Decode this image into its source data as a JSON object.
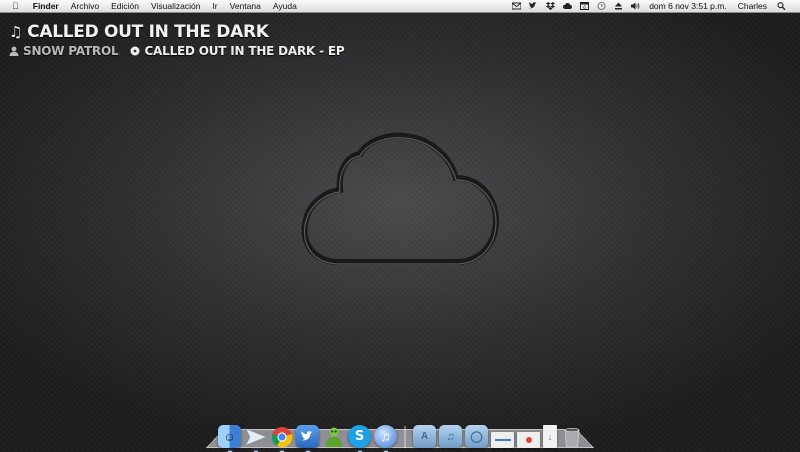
{
  "menubar": {
    "app_name": "Finder",
    "menus": [
      "Archivo",
      "Edición",
      "Visualización",
      "Ir",
      "Ventana",
      "Ayuda"
    ],
    "clock": "dom 6 nov  3:51 p.m.",
    "user": "Charles",
    "status_icons": [
      "mail-icon",
      "twitter-icon",
      "dropbox-icon",
      "cloud-icon",
      "calendar-icon",
      "clock-icon",
      "eject-icon",
      "volume-icon"
    ]
  },
  "now_playing": {
    "track": "CALLED OUT IN THE DARK",
    "artist": "SNOW PATROL",
    "album": "CALLED OUT IN THE DARK - EP"
  },
  "dock": {
    "apps": [
      {
        "name": "finder",
        "color": "#4a8fe0",
        "running": true
      },
      {
        "name": "sparrow",
        "color": "#dfe6ee",
        "running": true
      },
      {
        "name": "chrome",
        "color": "#e8e8e8",
        "running": true
      },
      {
        "name": "tweetbot",
        "color": "#3a7fd0",
        "running": true
      },
      {
        "name": "adium",
        "color": "#6fbf3a",
        "running": true
      },
      {
        "name": "skype",
        "color": "#1ea0e6",
        "running": true
      },
      {
        "name": "itunes",
        "color": "#5a8fd8",
        "running": true
      }
    ],
    "folders": [
      {
        "name": "applications-folder",
        "color": "#8ab0d8"
      },
      {
        "name": "music-folder",
        "color": "#8ab0d8"
      },
      {
        "name": "documents-folder",
        "color": "#8ab0d8"
      },
      {
        "name": "window-thumb-1",
        "color": "#e9e9e9"
      },
      {
        "name": "window-thumb-2",
        "color": "#e9e9e9"
      },
      {
        "name": "downloads-stack",
        "color": "#dcdcdc"
      },
      {
        "name": "trash",
        "color": "#9a9a9a"
      }
    ]
  }
}
